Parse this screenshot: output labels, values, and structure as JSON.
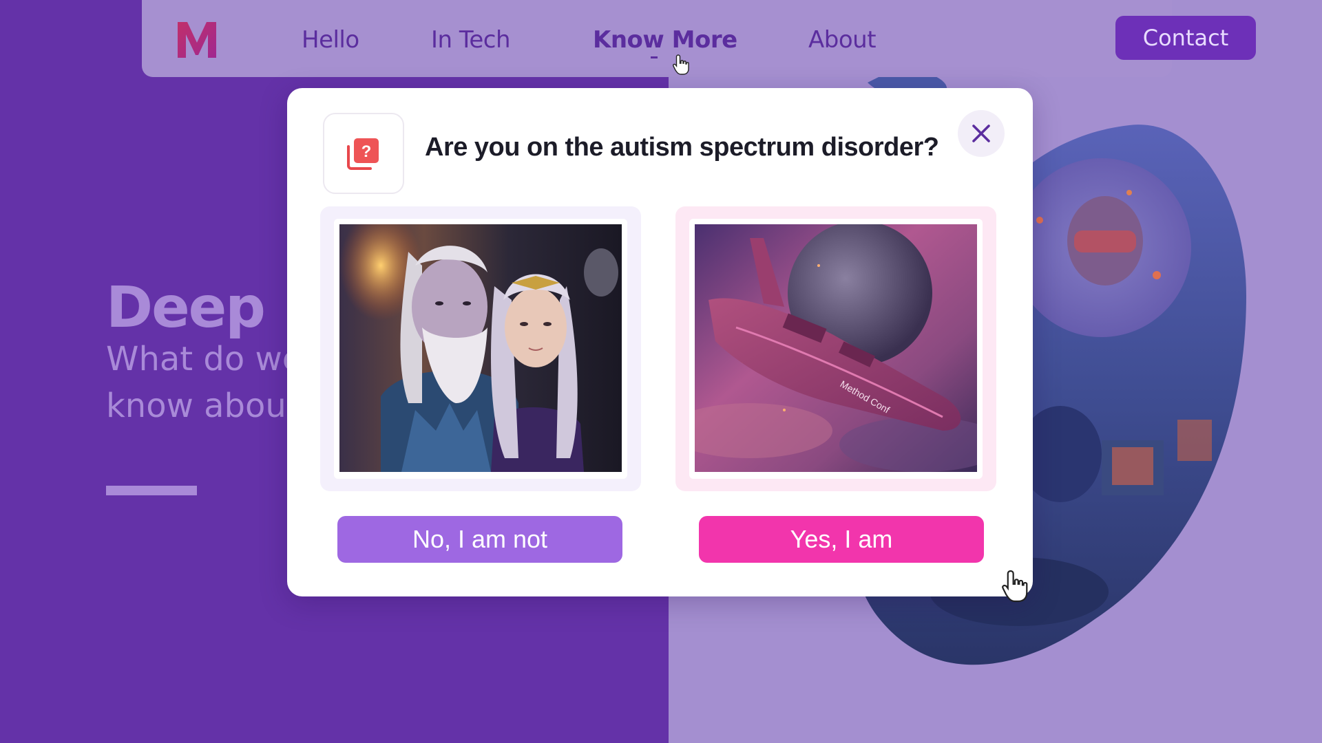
{
  "nav": {
    "items": [
      {
        "label": "Hello"
      },
      {
        "label": "In Tech"
      },
      {
        "label": "Know More",
        "active": true
      },
      {
        "label": "About"
      }
    ],
    "contact_label": "Contact"
  },
  "hero": {
    "title": "Deep D",
    "subtitle": "What do we know about"
  },
  "modal": {
    "title": "Are you on the autism spectrum disorder?",
    "options": [
      {
        "image": "elf-warriors-image"
      },
      {
        "image": "spaceship-image",
        "ship_text": "Method Conf"
      }
    ],
    "no_label": "No, I am not",
    "yes_label": "Yes, I am"
  },
  "colors": {
    "primary_purple": "#6432a8",
    "light_purple": "#a48fd0",
    "no_button": "#9e68e2",
    "yes_button": "#f235ac"
  }
}
